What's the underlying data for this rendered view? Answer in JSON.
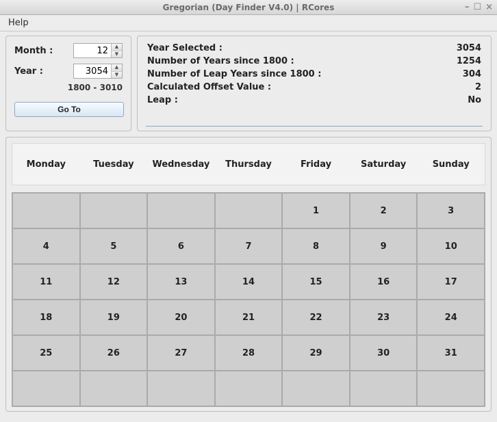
{
  "window": {
    "title": "Gregorian (Day Finder V4.0) | RCores"
  },
  "menu": {
    "help": "Help"
  },
  "inputs": {
    "month_label": "Month :",
    "month_value": "12",
    "year_label": "Year :",
    "year_value": "3054",
    "year_range": "1800 - 3010",
    "goto_label": "Go To"
  },
  "info": {
    "year_selected_label": "Year Selected :",
    "year_selected_value": "3054",
    "years_since_label": "Number of Years since 1800 :",
    "years_since_value": "1254",
    "leap_years_label": "Number of Leap Years since 1800 :",
    "leap_years_value": "304",
    "offset_label": "Calculated Offset Value :",
    "offset_value": "2",
    "leap_label": "Leap :",
    "leap_value": "No"
  },
  "days": {
    "d0": "Monday",
    "d1": "Tuesday",
    "d2": "Wednesday",
    "d3": "Thursday",
    "d4": "Friday",
    "d5": "Saturday",
    "d6": "Sunday"
  },
  "cells": {
    "c0": "",
    "c1": "",
    "c2": "",
    "c3": "",
    "c4": "1",
    "c5": "2",
    "c6": "3",
    "c7": "4",
    "c8": "5",
    "c9": "6",
    "c10": "7",
    "c11": "8",
    "c12": "9",
    "c13": "10",
    "c14": "11",
    "c15": "12",
    "c16": "13",
    "c17": "14",
    "c18": "15",
    "c19": "16",
    "c20": "17",
    "c21": "18",
    "c22": "19",
    "c23": "20",
    "c24": "21",
    "c25": "22",
    "c26": "23",
    "c27": "24",
    "c28": "25",
    "c29": "26",
    "c30": "27",
    "c31": "28",
    "c32": "29",
    "c33": "30",
    "c34": "31",
    "c35": "",
    "c36": "",
    "c37": "",
    "c38": "",
    "c39": "",
    "c40": "",
    "c41": ""
  }
}
